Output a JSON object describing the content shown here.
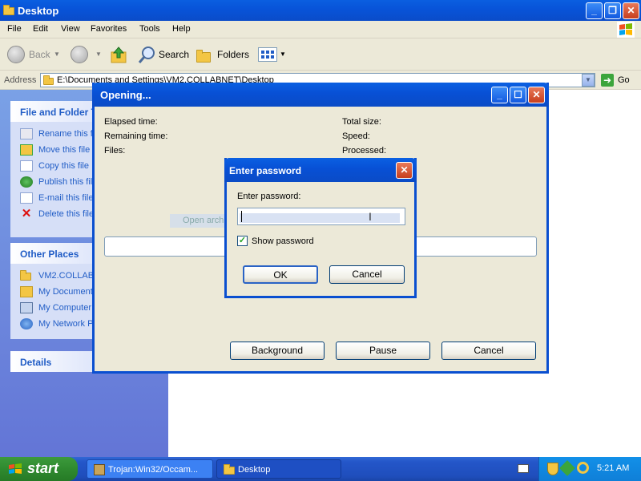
{
  "explorer": {
    "title": "Desktop",
    "menu": [
      "File",
      "Edit",
      "View",
      "Favorites",
      "Tools",
      "Help"
    ],
    "toolbar": {
      "back": "Back",
      "search": "Search",
      "folders": "Folders"
    },
    "address": {
      "label": "Address",
      "value": "E:\\Documents and Settings\\VM2.COLLABNET\\Desktop",
      "go": "Go"
    },
    "tasks": {
      "file_folder_title": "File and Folder T",
      "file_folder_items": [
        "Rename this f",
        "Move this file",
        "Copy this file",
        "Publish this fil",
        "E-mail this file",
        "Delete this file"
      ],
      "other_places_title": "Other Places",
      "other_places_items": [
        "VM2.COLLABN",
        "My Document",
        "My Computer",
        "My Network P"
      ],
      "details_title": "Details"
    }
  },
  "opening_dialog": {
    "title": "Opening...",
    "labels": {
      "elapsed": "Elapsed time:",
      "remaining": "Remaining time:",
      "files": "Files:",
      "total_size": "Total size:",
      "speed": "Speed:",
      "processed": "Processed:"
    },
    "ghost_text": "Open archive",
    "buttons": {
      "background": "Background",
      "pause": "Pause",
      "cancel": "Cancel"
    }
  },
  "password_dialog": {
    "title": "Enter password",
    "prompt": "Enter password:",
    "input_value": "",
    "show_password_label": "Show password",
    "show_password_checked": true,
    "ok": "OK",
    "cancel": "Cancel"
  },
  "taskbar": {
    "start": "start",
    "items": [
      "Trojan:Win32/Occam...",
      "Desktop"
    ],
    "clock": "5:21 AM"
  },
  "colors": {
    "titlebar": "#0a4fd0",
    "taskbar": "#2456c9",
    "start": "#2f8a2f",
    "sidepanel": "#6f8ddf"
  }
}
